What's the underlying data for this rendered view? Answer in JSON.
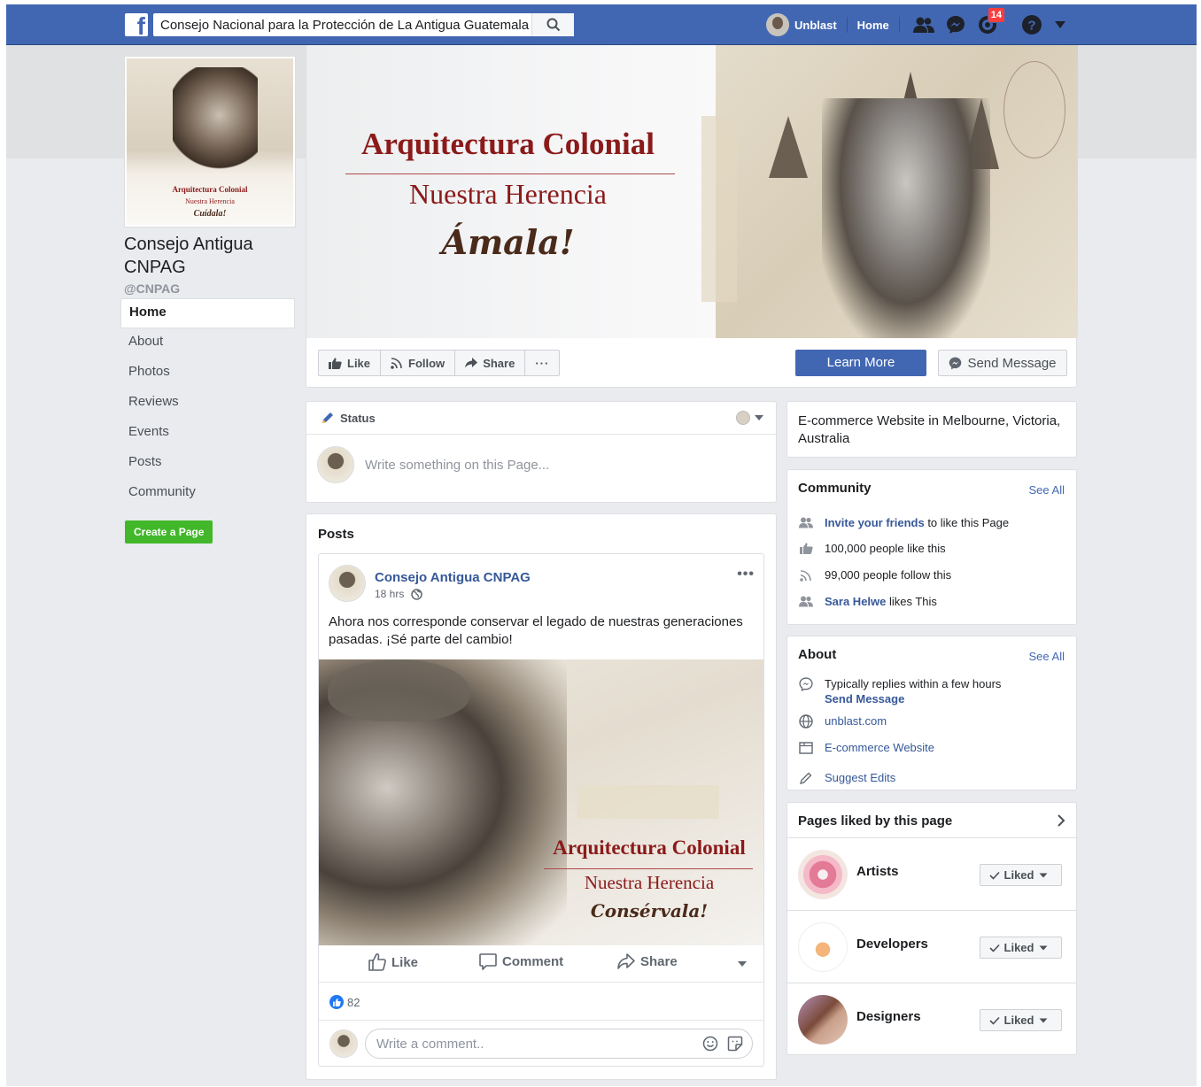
{
  "topbar": {
    "search_value": "Consejo Nacional para la Protección de La Antigua Guatemala",
    "user_name": "Unblast",
    "home_label": "Home",
    "notifications_count": "14"
  },
  "page": {
    "name": "Consejo Antigua CNPAG",
    "handle": "@CNPAG",
    "profile_pic_text": {
      "line1": "Arquitectura Colonial",
      "line2": "Nuestra Herencia",
      "line3": "Cuídala!"
    }
  },
  "left_nav": {
    "items": [
      "Home",
      "About",
      "Photos",
      "Reviews",
      "Events",
      "Posts",
      "Community"
    ],
    "create_page_label": "Create a Page"
  },
  "cover": {
    "title": "Arquitectura Colonial",
    "subtitle": "Nuestra Herencia",
    "script": "Ámala!"
  },
  "page_actions": {
    "like_label": "Like",
    "follow_label": "Follow",
    "share_label": "Share",
    "more_label": "···",
    "learn_more_label": "Learn More",
    "send_message_label": "Send Message"
  },
  "composer": {
    "status_label": "Status",
    "placeholder": "Write something on this Page..."
  },
  "posts": {
    "section_title": "Posts",
    "post": {
      "author": "Consejo Antigua CNPAG",
      "time": "18 hrs",
      "more": "•••",
      "text": "Ahora nos corresponde conservar el legado de nuestras generaciones pasadas. ¡Sé parte del cambio!",
      "image_text": {
        "line1": "Arquitectura Colonial",
        "line2": "Nuestra Herencia",
        "line3": "Consérvala!"
      },
      "like_label": "Like",
      "comment_label": "Comment",
      "share_label": "Share",
      "reaction_count": "82",
      "comment_placeholder": "Write a comment.."
    }
  },
  "right": {
    "category_text": "E-commerce Website in Melbourne, Victoria, Australia",
    "community": {
      "title": "Community",
      "see_all": "See All",
      "invite_link": "Invite your friends",
      "invite_rest": " to like this Page",
      "likes_text": "100,000 people like this",
      "follows_text": "99,000 people follow this",
      "friend_name": "Sara Helwe",
      "friend_rest": " likes This"
    },
    "about": {
      "title": "About",
      "see_all": "See All",
      "replies_text": "Typically replies within a few hours",
      "send_message": "Send Message",
      "website": "unblast.com",
      "category": "E-commerce Website",
      "suggest": "Suggest Edits"
    },
    "pages_liked": {
      "title": "Pages liked by this page",
      "items": [
        {
          "name": "Artists",
          "button": "Liked"
        },
        {
          "name": "Developers",
          "button": "Liked"
        },
        {
          "name": "Designers",
          "button": "Liked"
        }
      ]
    }
  },
  "colors": {
    "brand_blue": "#4267b2",
    "link_blue": "#365899",
    "create_green": "#42b72a",
    "badge_red": "#fa3e3e",
    "heritage_red": "#8b1a1a"
  },
  "icons": [
    "facebook-logo-icon",
    "search-icon",
    "friends-icon",
    "messenger-icon",
    "notifications-icon",
    "help-icon",
    "dropdown-icon",
    "like-icon",
    "follow-icon",
    "share-icon",
    "pencil-icon",
    "globe-icon",
    "comment-icon",
    "emoji-icon",
    "sticker-icon",
    "people-icon",
    "thumb-icon",
    "rss-icon",
    "browser-icon",
    "check-icon",
    "chevron-right-icon"
  ]
}
